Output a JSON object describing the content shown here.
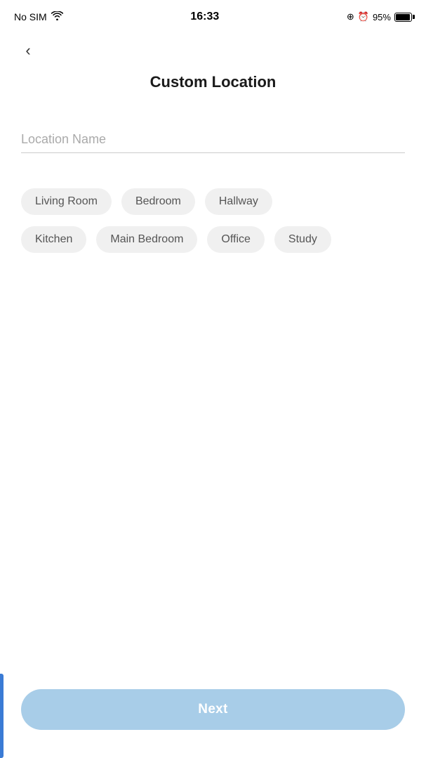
{
  "statusBar": {
    "carrier": "No SIM",
    "time": "16:33",
    "batteryPercent": "95%"
  },
  "header": {
    "backLabel": "‹",
    "title": "Custom Location"
  },
  "input": {
    "placeholder": "Location Name",
    "value": ""
  },
  "tags": {
    "row1": [
      {
        "id": "living-room",
        "label": "Living Room"
      },
      {
        "id": "bedroom",
        "label": "Bedroom"
      },
      {
        "id": "hallway",
        "label": "Hallway"
      }
    ],
    "row2": [
      {
        "id": "kitchen",
        "label": "Kitchen"
      },
      {
        "id": "main-bedroom",
        "label": "Main Bedroom"
      },
      {
        "id": "office",
        "label": "Office"
      },
      {
        "id": "study",
        "label": "Study"
      }
    ]
  },
  "nextButton": {
    "label": "Next"
  }
}
